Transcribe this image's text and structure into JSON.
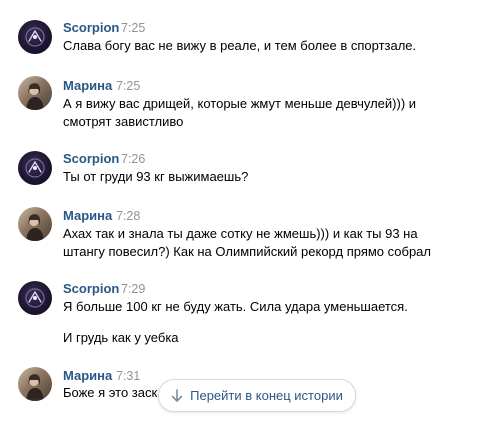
{
  "messages": [
    {
      "author": "Scorpion",
      "time": "7:25",
      "avatar": "scorpion",
      "lines": [
        "Слава богу вас не вижу в реале, и тем более в спортзале."
      ]
    },
    {
      "author": "Марина",
      "time": "7:25",
      "avatar": "marina",
      "lines": [
        "А я вижу вас дрищей, которые жмут меньше девчулей))) и",
        "смотрят завистливо"
      ]
    },
    {
      "author": "Scorpion",
      "time": "7:26",
      "avatar": "scorpion",
      "lines": [
        "Ты от груди 93 кг выжимаешь?"
      ]
    },
    {
      "author": "Марина",
      "time": "7:28",
      "avatar": "marina",
      "lines": [
        "Ахах так и знала ты даже сотку не жмешь))) и как ты 93 на",
        "штангу повесил?) Как на Олимпийский рекорд прямо собрал"
      ]
    },
    {
      "author": "Scorpion",
      "time": "7:29",
      "avatar": "scorpion",
      "lines": [
        "Я больше 100 кг не буду жать. Сила удара уменьшается."
      ],
      "extra": "И грудь как у уебка"
    },
    {
      "author": "Марина",
      "time": "7:31",
      "avatar": "marina",
      "lines": [
        "Боже я это заск"
      ]
    }
  ],
  "jump_button": {
    "label": "Перейти в конец истории",
    "icon": "arrow-down-icon"
  },
  "colors": {
    "author": "#2a5885",
    "time": "#939393",
    "text": "#000000",
    "button_border": "#d3d9de"
  }
}
